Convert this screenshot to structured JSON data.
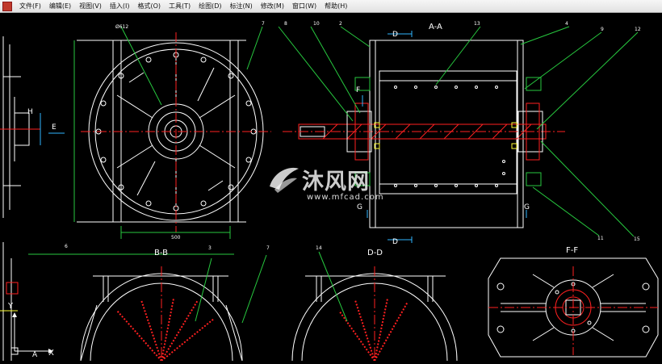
{
  "menubar": {
    "items": [
      "文件(F)",
      "编辑(E)",
      "视图(V)",
      "插入(I)",
      "格式(O)",
      "工具(T)",
      "绘图(D)",
      "标注(N)",
      "修改(M)",
      "窗口(W)",
      "帮助(H)"
    ]
  },
  "drawing": {
    "section_labels": {
      "aa": "A-A",
      "bb": "B-B",
      "dd": "D-D",
      "ff": "F-F"
    },
    "view_markers": {
      "d_top": "D",
      "d_bottom": "D",
      "e": "E",
      "f": "F",
      "g_left": "G",
      "g_right": "G",
      "h": "H",
      "a": "A"
    },
    "balloons": {
      "b7a": "7",
      "b8": "8",
      "b10": "10",
      "b2": "2",
      "b13": "13",
      "b4": "4",
      "b9": "9",
      "b12": "12",
      "b11": "11",
      "b15": "15",
      "b6": "6",
      "b3": "3",
      "b7b": "7",
      "b14": "14"
    },
    "dimensions": {
      "dim_500": "500",
      "dim_diam": "Ø612"
    }
  },
  "ucs": {
    "x_label": "X",
    "y_label": "Y"
  },
  "watermark": {
    "brand": "沐风网",
    "url": "www.mfcad.com"
  },
  "colors": {
    "background": "#000000",
    "line_white": "#ffffff",
    "line_red": "#ff2020",
    "line_green": "#27c93f",
    "line_yellow": "#ffff33",
    "line_cyan": "#2fb6ff"
  }
}
